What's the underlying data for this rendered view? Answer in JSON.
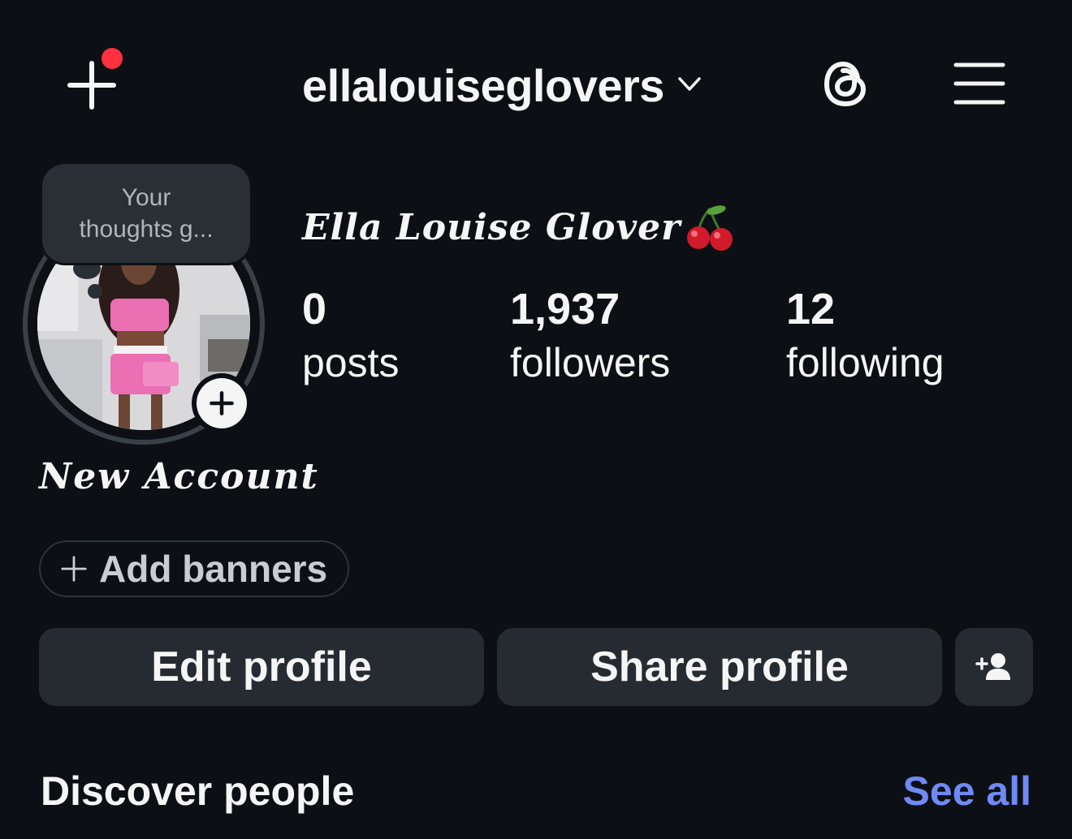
{
  "header": {
    "username": "ellalouiseglovers",
    "new_post_icon": "plus-icon",
    "threads_icon": "threads-icon",
    "menu_icon": "hamburger-menu-icon",
    "notification_color": "#ff3040"
  },
  "note": {
    "line1": "Your",
    "line2": "thoughts g..."
  },
  "profile": {
    "display_name": "Ella Louise Glover",
    "emoji": "cherries",
    "bio_name": "New Account"
  },
  "stats": [
    {
      "value": "0",
      "label": "posts"
    },
    {
      "value": "1,937",
      "label": "followers"
    },
    {
      "value": "12",
      "label": "following"
    }
  ],
  "banners": {
    "label": "Add banners"
  },
  "actions": {
    "edit": "Edit profile",
    "share": "Share profile",
    "add_person_icon": "add-person-icon"
  },
  "discover": {
    "title": "Discover people",
    "see_all": "See all",
    "see_all_color": "#6f89f5"
  }
}
